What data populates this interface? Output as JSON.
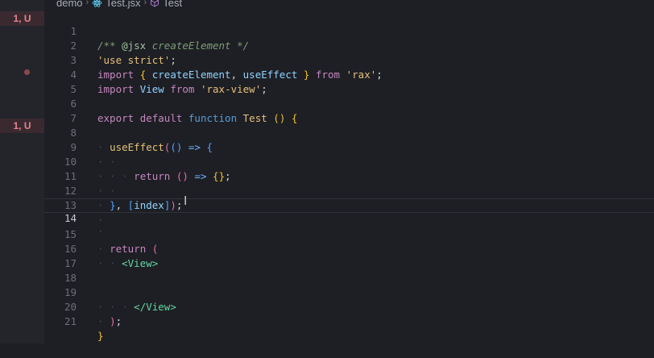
{
  "breadcrumb": {
    "folder": "demo",
    "file": "Test.jsx",
    "symbol": "Test"
  },
  "git_badges": [
    "1, U",
    "1, U"
  ],
  "lines": [
    {
      "n": "1",
      "text": "/** @jsx createElement */"
    },
    {
      "n": "2",
      "text": "'use strict';"
    },
    {
      "n": "3",
      "text": "import { createElement, useEffect } from 'rax';"
    },
    {
      "n": "4",
      "text": "import View from 'rax-view';"
    },
    {
      "n": "5",
      "text": ""
    },
    {
      "n": "6",
      "text": "export default function Test () {"
    },
    {
      "n": "7",
      "text": ""
    },
    {
      "n": "8",
      "text": "  useEffect(() => {"
    },
    {
      "n": "9",
      "text": ""
    },
    {
      "n": "10",
      "text": "    return () => {};"
    },
    {
      "n": "11",
      "text": ""
    },
    {
      "n": "12",
      "text": "  }, [index]);"
    },
    {
      "n": "13",
      "text": ""
    },
    {
      "n": "14",
      "text": ""
    },
    {
      "n": "15",
      "text": "  return ("
    },
    {
      "n": "16",
      "text": "    <View>"
    },
    {
      "n": "17",
      "text": ""
    },
    {
      "n": "18",
      "text": ""
    },
    {
      "n": "19",
      "text": "    </View>"
    },
    {
      "n": "20",
      "text": "  );"
    },
    {
      "n": "21",
      "text": "}"
    }
  ],
  "active_line": "14",
  "colors": {
    "background": "#1e1f24",
    "keyword": "#569cd6",
    "string": "#e6c07b",
    "jsx_tag": "#62d4a0",
    "git_modified": "#e8828e"
  }
}
